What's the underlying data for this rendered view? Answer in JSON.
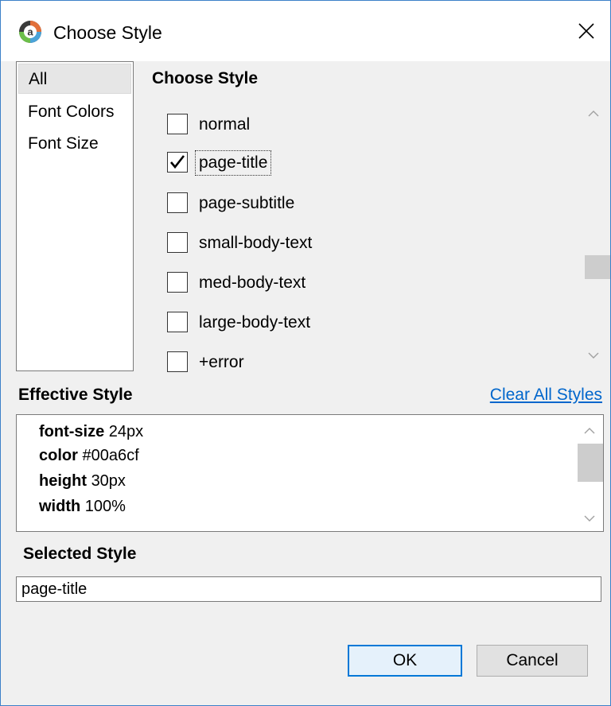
{
  "window": {
    "title": "Choose Style"
  },
  "categories": [
    {
      "label": "All",
      "selected": true
    },
    {
      "label": "Font Colors",
      "selected": false
    },
    {
      "label": "Font Size",
      "selected": false
    }
  ],
  "choose": {
    "heading": "Choose Style",
    "styles": [
      {
        "label": "normal",
        "checked": false
      },
      {
        "label": "page-title",
        "checked": true
      },
      {
        "label": "page-subtitle",
        "checked": false
      },
      {
        "label": "small-body-text",
        "checked": false
      },
      {
        "label": "med-body-text",
        "checked": false
      },
      {
        "label": "large-body-text",
        "checked": false
      },
      {
        "label": "+error",
        "checked": false
      }
    ]
  },
  "effective": {
    "heading": "Effective Style",
    "clear_label": "Clear All Styles",
    "properties": [
      {
        "name": "font-size",
        "value": "24px"
      },
      {
        "name": "color",
        "value": "#00a6cf"
      },
      {
        "name": "height",
        "value": "30px"
      },
      {
        "name": "width",
        "value": "100%"
      }
    ]
  },
  "selected": {
    "heading": "Selected Style",
    "value": "page-title"
  },
  "buttons": {
    "ok": "OK",
    "cancel": "Cancel"
  },
  "icons": {
    "app": "app-logo-icon",
    "close": "close-icon"
  },
  "colors": {
    "link": "#0066cc",
    "focus": "#0078d7",
    "window_border": "#3c80c8"
  }
}
